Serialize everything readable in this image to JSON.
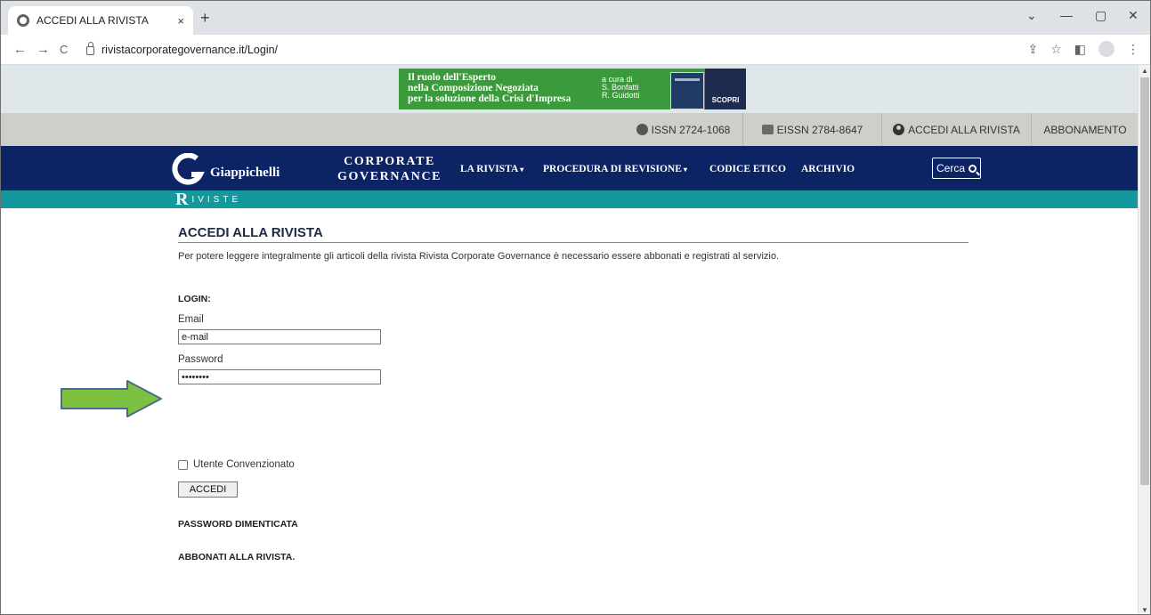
{
  "browser": {
    "tab_title": "ACCEDI ALLA RIVISTA",
    "tab_close": "×",
    "new_tab": "+",
    "url": "rivistacorporategovernance.it/Login/",
    "win_min": "—",
    "win_max": "▢",
    "win_close": "✕",
    "tab_menu": "⌄",
    "nav_back": "←",
    "nav_forward": "→",
    "nav_reload": "C",
    "icon_share": "⇪",
    "icon_star": "☆",
    "icon_sidepanel": "◧",
    "icon_menu": "⋮"
  },
  "banner": {
    "line1": "Il ruolo dell'Esperto",
    "line2": "nella Composizione Negoziata",
    "line3": "per la soluzione della Crisi d'Impresa",
    "credit1": "a cura di",
    "credit2": "S. Bonfatti",
    "credit3": "R. Guidotti",
    "cta": "SCOPRI"
  },
  "util_nav": {
    "issn": "ISSN 2724-1068",
    "eissn": "EISSN 2784-8647",
    "login": "ACCEDI ALLA RIVISTA",
    "subscribe": "ABBONAMENTO"
  },
  "main_nav": {
    "logo_text": "Giappichelli",
    "journal_line1": "CORPORATE",
    "journal_line2": "GOVERNANCE",
    "items": [
      {
        "label": "LA RIVISTA",
        "caret": "▾"
      },
      {
        "label": "PROCEDURA DI REVISIONE",
        "caret": "▾"
      },
      {
        "label": "CODICE ETICO",
        "caret": ""
      },
      {
        "label": "ARCHIVIO",
        "caret": ""
      }
    ],
    "search_label": "Cerca",
    "sub_brand_initial": "R",
    "sub_brand_rest": "IVISTE"
  },
  "content": {
    "title": "ACCEDI ALLA RIVISTA",
    "intro": "Per potere leggere integralmente gli articoli della rivista Rivista Corporate Governance è necessario essere abbonati e registrati al servizio.",
    "login_label": "LOGIN:",
    "email_label": "Email",
    "email_value": "e-mail",
    "password_label": "Password",
    "password_value": "••••••••",
    "checkbox_label": "Utente Convenzionato",
    "submit_label": "ACCEDI",
    "forgot_link": "PASSWORD DIMENTICATA",
    "subscribe_link": "ABBONATI ALLA RIVISTA."
  },
  "colors": {
    "navy": "#0c2464",
    "teal": "#13999b",
    "banner_green": "#3a9a3c",
    "util_gray": "#cfcfca",
    "annotation_arrow": "#7dc142"
  }
}
